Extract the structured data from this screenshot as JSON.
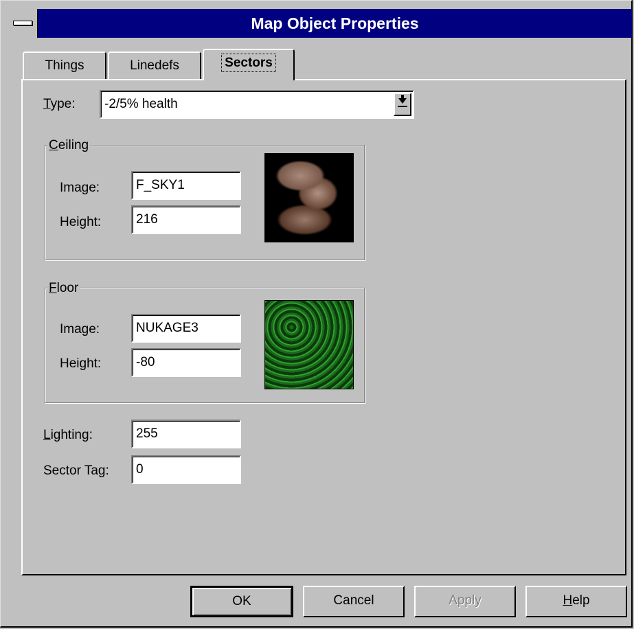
{
  "window": {
    "title": "Map Object Properties"
  },
  "tabs": [
    {
      "label": "Things",
      "active": false
    },
    {
      "label": "Linedefs",
      "active": false
    },
    {
      "label": "Sectors",
      "active": true
    }
  ],
  "sectors": {
    "type": {
      "label_first": "T",
      "label_rest": "ype:",
      "value": "-2/5% health"
    },
    "ceiling": {
      "group_first": "C",
      "group_rest": "eiling",
      "image_label": "Image:",
      "image_value": "F_SKY1",
      "height_label": "Height:",
      "height_value": "216"
    },
    "floor": {
      "group_first": "F",
      "group_rest": "loor",
      "image_label": "Image:",
      "image_value": "NUKAGE3",
      "height_label": "Height:",
      "height_value": "-80"
    },
    "lighting": {
      "label_first": "L",
      "label_rest": "ighting:",
      "value": "255"
    },
    "sector_tag": {
      "label": "Sector Tag:",
      "value": "0"
    }
  },
  "buttons": {
    "ok": "OK",
    "cancel": "Cancel",
    "apply": "Apply",
    "help_first": "H",
    "help_rest": "elp"
  },
  "icons": {
    "sysmenu": "system-menu-icon",
    "dropdown": "dropdown-arrow-icon"
  }
}
